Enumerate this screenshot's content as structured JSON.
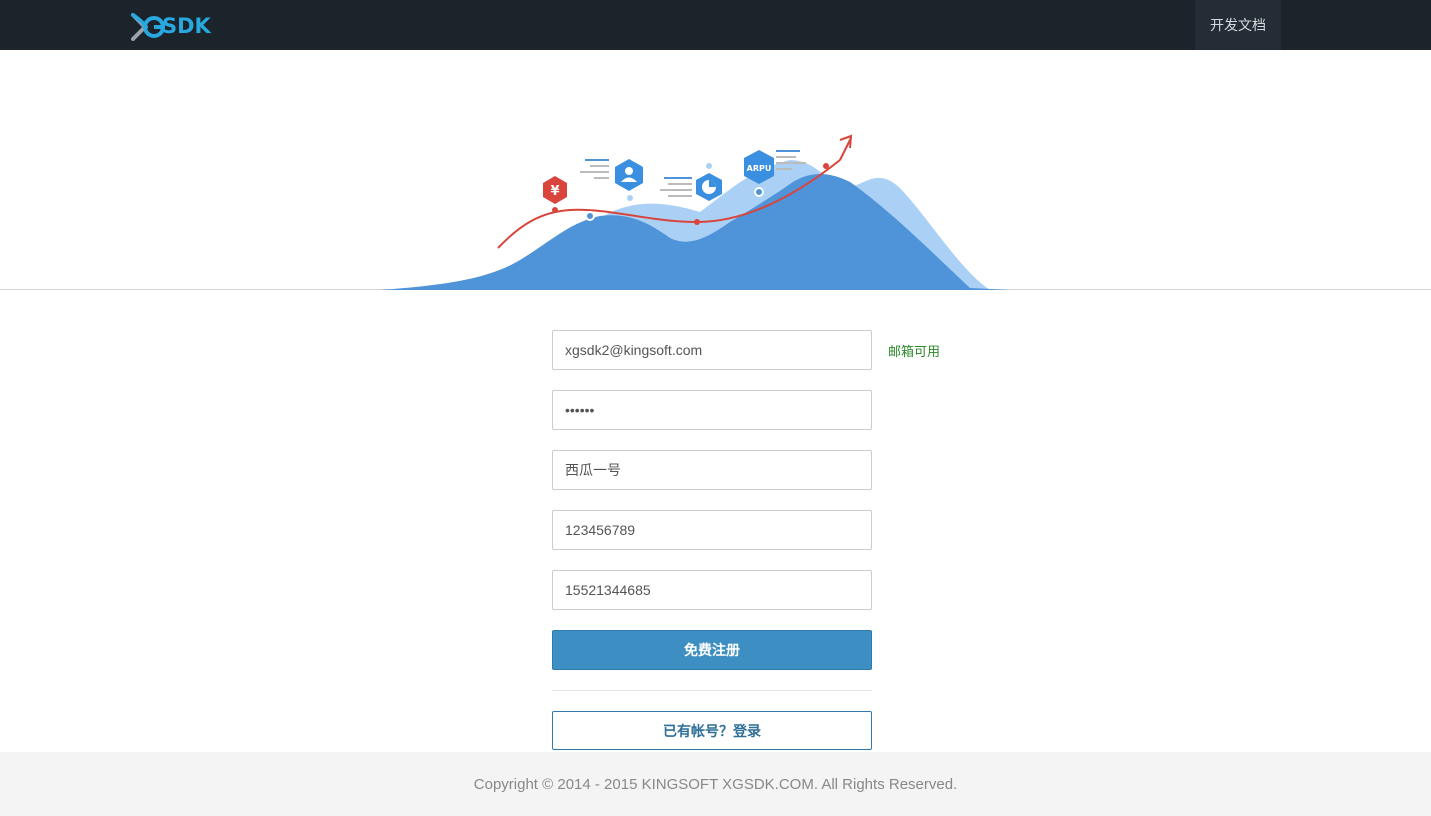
{
  "navbar": {
    "logo_text": "SDK",
    "doc_link": "开发文档"
  },
  "hero": {
    "badge_currency": "¥",
    "badge_arpu": "ARPU"
  },
  "form": {
    "email": "xgsdk2@kingsoft.com",
    "email_status": "邮箱可用",
    "password": "••••••",
    "nickname": "西瓜一号",
    "qq": "123456789",
    "phone": "15521344685",
    "register_label": "免费注册",
    "login_label": "已有帐号？登录"
  },
  "footer": {
    "copyright": "Copyright © 2014 - 2015 KINGSOFT XGSDK.COM. All Rights Reserved."
  },
  "colors": {
    "navbar_bg": "#1b232b",
    "accent_blue": "#3d8ec2",
    "success_green": "#2b8a2b",
    "curve_red": "#d9443c"
  }
}
